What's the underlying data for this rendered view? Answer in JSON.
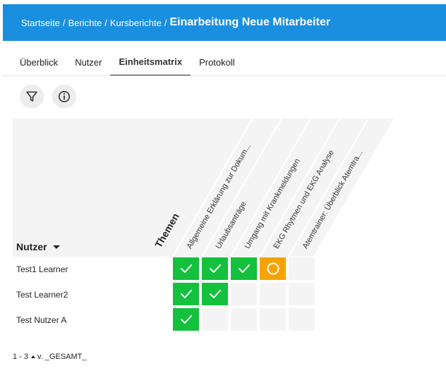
{
  "breadcrumb": {
    "items": [
      "Startseite",
      "Berichte",
      "Kursberichte"
    ],
    "separator": "/",
    "current": "Einarbeitung Neue Mitarbeiter"
  },
  "tabs": [
    {
      "label": "Überblick",
      "active": false
    },
    {
      "label": "Nutzer",
      "active": false
    },
    {
      "label": "Einheitsmatrix",
      "active": true
    },
    {
      "label": "Protokoll",
      "active": false
    }
  ],
  "toolbar": {
    "filter_icon": "filter-icon",
    "info_icon": "info-icon"
  },
  "matrix": {
    "themen_label": "Themen",
    "nutzer_label": "Nutzer",
    "topics": [
      "Allgemeine Erklärung zur Dokum...",
      "Urlaubsanträge",
      "Umgang mit Krankmeldungen",
      "EKG Rhytmen und EKG Analyse",
      "Atemtrainer: Überblick Atemtra..."
    ],
    "rows": [
      {
        "name": "Test1 Learner",
        "cells": [
          "done",
          "done",
          "done",
          "progress",
          "empty"
        ]
      },
      {
        "name": "Test Learner2",
        "cells": [
          "done",
          "done",
          "empty",
          "empty",
          "empty"
        ]
      },
      {
        "name": "Test Nutzer A",
        "cells": [
          "done",
          "empty",
          "empty",
          "empty",
          "empty"
        ]
      }
    ]
  },
  "footer": {
    "range": "1 - 3",
    "of": "v. _GESAMT_"
  },
  "colors": {
    "header": "#1a8fe0",
    "done": "#13c13c",
    "progress": "#f5a300",
    "empty": "#f4f4f4"
  }
}
